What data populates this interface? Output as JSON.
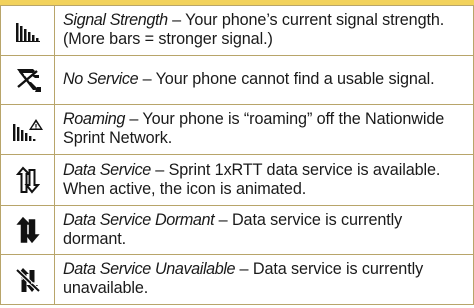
{
  "accent_band_color": "#f2d25c",
  "rows": [
    {
      "icon": "signal-strength-icon",
      "term": "Signal Strength",
      "separator": " – ",
      "text": "Your phone’s current signal strength. (More bars = stronger signal.)"
    },
    {
      "icon": "no-service-icon",
      "term": "No Service",
      "separator": " – ",
      "text": "Your phone cannot find a usable signal."
    },
    {
      "icon": "roaming-icon",
      "term": "Roaming",
      "separator": " – ",
      "text": "Your phone is “roaming” off the Nationwide Sprint Network."
    },
    {
      "icon": "data-service-icon",
      "term": "Data Service",
      "separator": " – ",
      "text": "Sprint 1xRTT data service is available. When active, the icon is animated."
    },
    {
      "icon": "data-service-dormant-icon",
      "term": "Data Service Dormant",
      "separator": " – ",
      "text": "Data service is currently dormant."
    },
    {
      "icon": "data-service-unavailable-icon",
      "term": "Data Service Unavailable",
      "separator": " – ",
      "text": "Data service is currently unavailable."
    }
  ]
}
